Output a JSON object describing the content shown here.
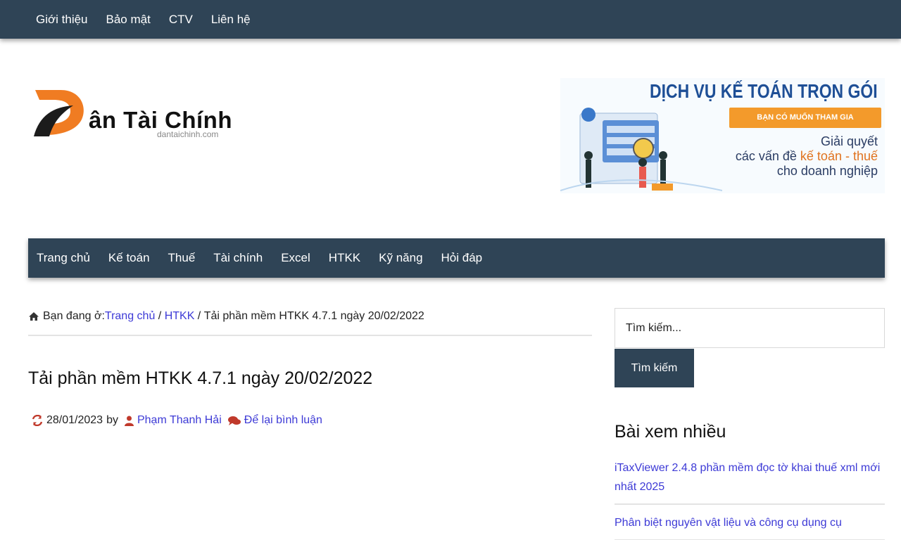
{
  "topnav": {
    "items": [
      "Giới thiệu",
      "Bảo mật",
      "CTV",
      "Liên hệ"
    ]
  },
  "logo": {
    "title": "ân Tài Chính",
    "domain": "dantaichinh.com"
  },
  "banner": {
    "title": "DỊCH VỤ KẾ TOÁN TRỌN GÓI",
    "cta": "BẠN CÓ MUỐN THAM GIA",
    "line1": "Giải quyết",
    "line2_pre": "các vấn đề ",
    "line2_hl": "kế toán - thuế",
    "line3": "cho doanh nghiệp"
  },
  "mainnav": {
    "items": [
      "Trang chủ",
      "Kế toán",
      "Thuế",
      "Tài chính",
      "Excel",
      "HTKK",
      "Kỹ năng",
      "Hỏi đáp"
    ]
  },
  "breadcrumb": {
    "prefix": "Bạn đang ở:",
    "home": "Trang chủ",
    "sep": " / ",
    "category": "HTKK",
    "current": "Tải phần mềm HTKK 4.7.1 ngày 20/02/2022"
  },
  "post": {
    "title": "Tải phần mềm HTKK 4.7.1 ngày 20/02/2022",
    "date": "28/01/2023",
    "by": "by",
    "author": "Phạm Thanh Hải",
    "comment": "Để lại bình luận"
  },
  "sidebar": {
    "search_placeholder": "Tìm kiếm...",
    "search_button": "Tìm kiếm",
    "popular_title": "Bài xem nhiều",
    "popular": [
      "iTaxViewer 2.4.8 phần mềm đọc tờ khai thuế xml mới nhất 2025",
      "Phân biệt nguyên vật liệu và công cụ dụng cụ"
    ]
  },
  "colors": {
    "nav_bg": "#2f4456",
    "link": "#3d3ad6",
    "icon_red": "#c0392b",
    "banner_orange": "#f39a2b"
  }
}
